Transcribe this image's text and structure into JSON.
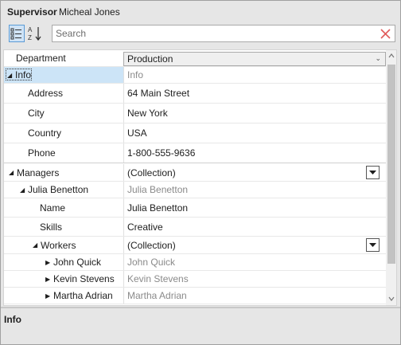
{
  "header": {
    "selected_type": "Supervisor",
    "selected_name": "Micheal Jones"
  },
  "toolbar": {
    "search_placeholder": "Search",
    "search_value": ""
  },
  "rows": {
    "department": {
      "name": "Department",
      "value": "Production"
    },
    "info": {
      "name": "Info",
      "value": "Info"
    },
    "address": {
      "name": "Address",
      "value": "64 Main Street"
    },
    "city": {
      "name": "City",
      "value": "New York"
    },
    "country": {
      "name": "Country",
      "value": "USA"
    },
    "phone": {
      "name": "Phone",
      "value": "1-800-555-9636"
    },
    "managers": {
      "name": "Managers",
      "value": "(Collection)"
    },
    "julia": {
      "name": "Julia Benetton",
      "value": "Julia Benetton"
    },
    "julia_name": {
      "name": "Name",
      "value": "Julia Benetton"
    },
    "julia_skills": {
      "name": "Skills",
      "value": "Creative"
    },
    "workers": {
      "name": "Workers",
      "value": "(Collection)"
    },
    "john": {
      "name": "John Quick",
      "value": "John Quick"
    },
    "kevin": {
      "name": "Kevin Stevens",
      "value": "Kevin Stevens"
    },
    "martha": {
      "name": "Martha Adrian",
      "value": "Martha Adrian"
    }
  },
  "description": {
    "title": "Info"
  },
  "icons": {
    "categorize": "categorize-icon",
    "sort_alpha": "sort-alphabetical-icon",
    "clear": "clear-search-icon",
    "expand": "expand-triangle-icon",
    "collapse": "collapse-triangle-icon"
  },
  "colors": {
    "selection": "#cce4f7",
    "accent": "#5b9bd5",
    "clear_x": "#e05a5a"
  }
}
